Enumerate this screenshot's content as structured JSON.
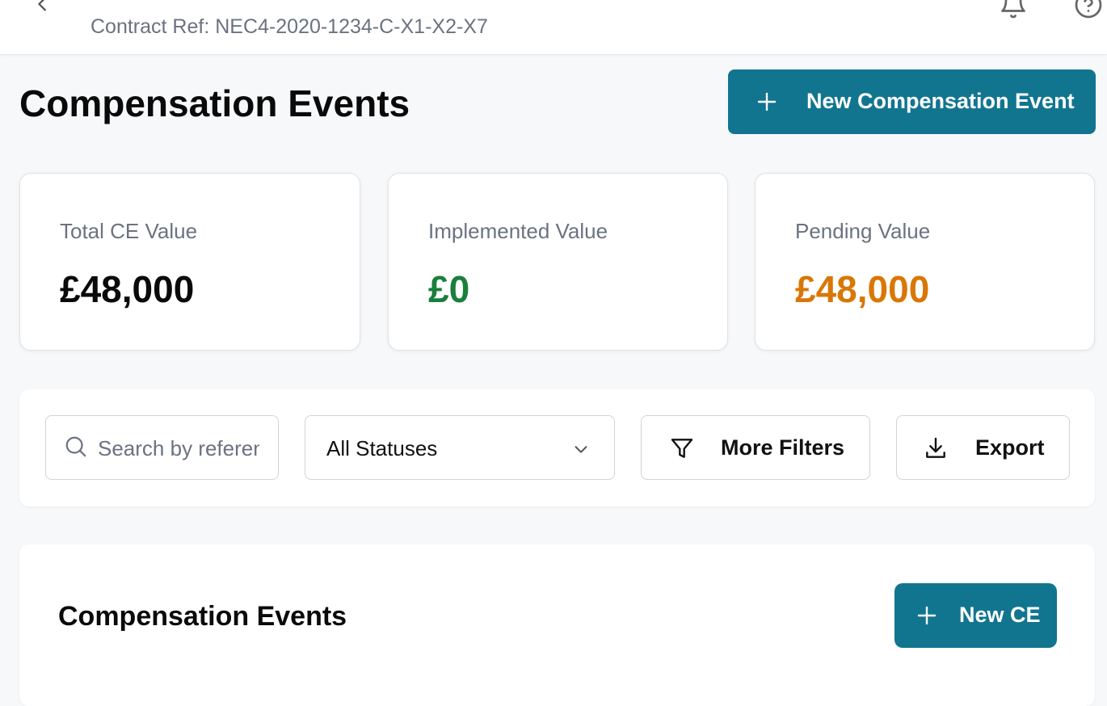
{
  "header": {
    "contract_ref": "Contract Ref: NEC4-2020-1234-C-X1-X2-X7",
    "icons": [
      "chevron-left-icon",
      "bell-icon",
      "help-circle-icon"
    ]
  },
  "page": {
    "title": "Compensation Events",
    "new_button_label": "New Compensation Event"
  },
  "summary": {
    "total": {
      "label": "Total CE Value",
      "value": "£48,000"
    },
    "implemented": {
      "label": "Implemented Value",
      "value": "£0",
      "color": "#1a7f3c"
    },
    "pending": {
      "label": "Pending Value",
      "value": "£48,000",
      "color": "#d97706"
    }
  },
  "filters": {
    "search_placeholder": "Search by reference...",
    "status_selected": "All Statuses",
    "more_filters_label": "More Filters",
    "export_label": "Export"
  },
  "list": {
    "title": "Compensation Events",
    "new_button_label": "New CE"
  },
  "colors": {
    "primary": "#127590",
    "muted_text": "#6b7280"
  }
}
